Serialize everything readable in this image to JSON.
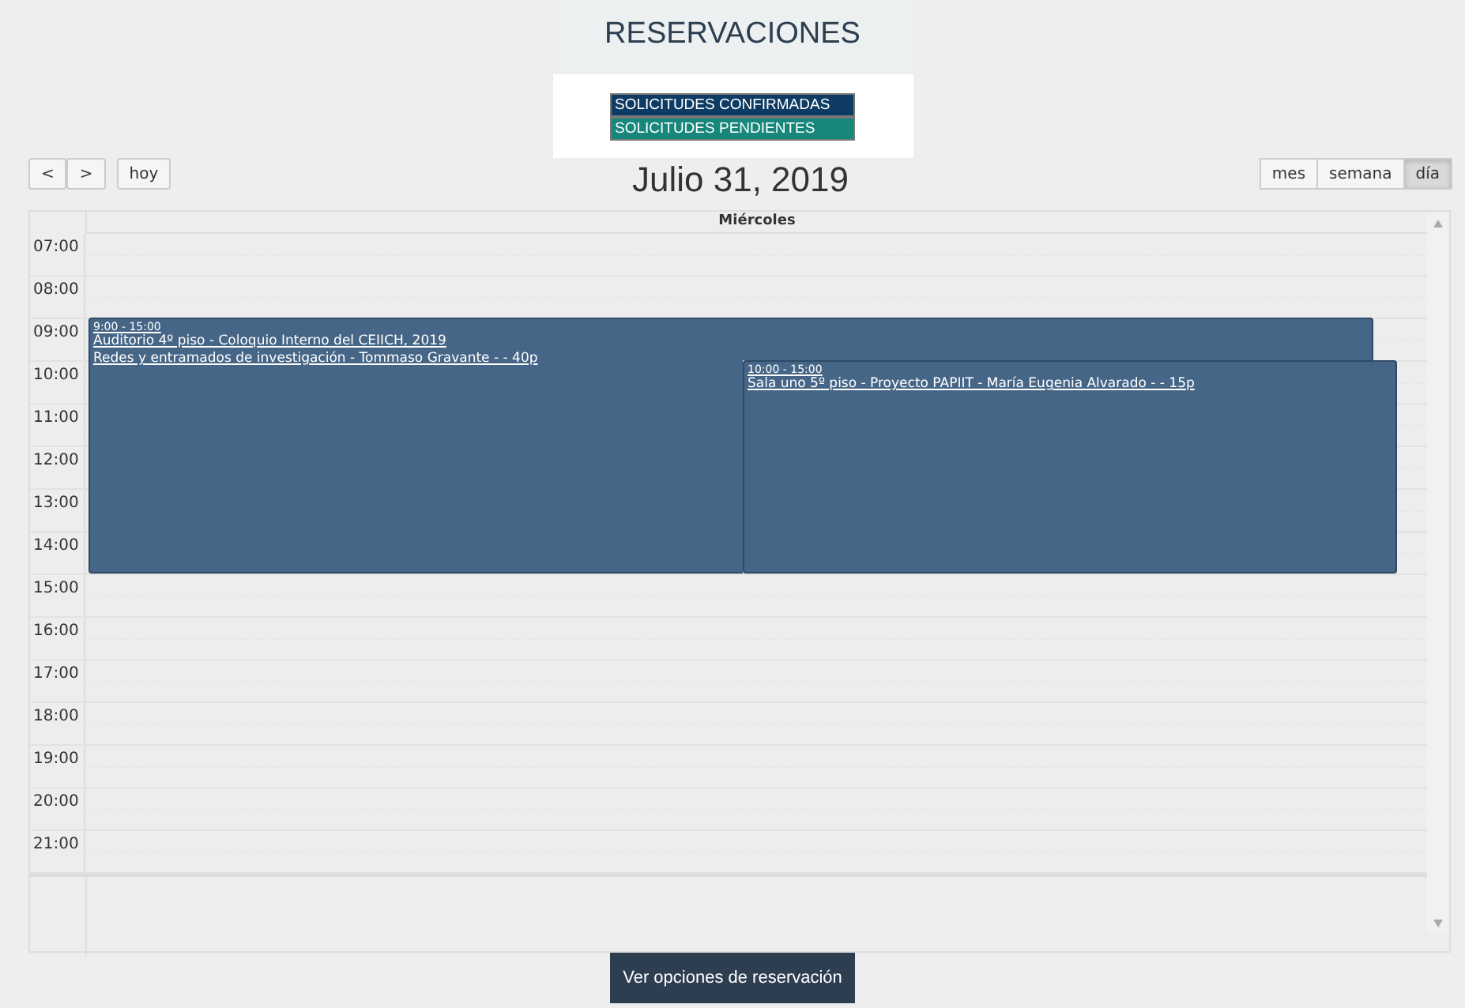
{
  "header": {
    "title": "RESERVACIONES"
  },
  "legend": [
    {
      "label": "SOLICITUDES CONFIRMADAS",
      "color": "#0d3b63"
    },
    {
      "label": "SOLICITUDES PENDIENTES",
      "color": "#16877a"
    }
  ],
  "nav_buttons": [
    "<",
    ">",
    "hoy"
  ],
  "date_title": "Julio 31, 2019",
  "views": [
    {
      "label": "mes",
      "selected": false
    },
    {
      "label": "semana",
      "selected": false
    },
    {
      "label": "día",
      "selected": true
    }
  ],
  "calendar": {
    "day_header": "Miércoles",
    "hours": [
      "07:00",
      "08:00",
      "09:00",
      "10:00",
      "11:00",
      "12:00",
      "13:00",
      "14:00",
      "15:00",
      "16:00",
      "17:00",
      "18:00",
      "19:00",
      "20:00",
      "21:00"
    ],
    "events": [
      {
        "time": "9:00 - 15:00",
        "lines": [
          "Auditorio 4º piso - Coloquio Interno del CEIICH, 2019 ",
          "Redes y entramados de investigación - Tommaso Gravante - - 40p"
        ]
      },
      {
        "time": "10:00 - 15:00",
        "lines": [
          "Sala uno 5º piso - Proyecto PAPIIT - María Eugenia Alvarado - - 15p"
        ]
      }
    ]
  },
  "footer_button": "Ver opciones de reservación"
}
